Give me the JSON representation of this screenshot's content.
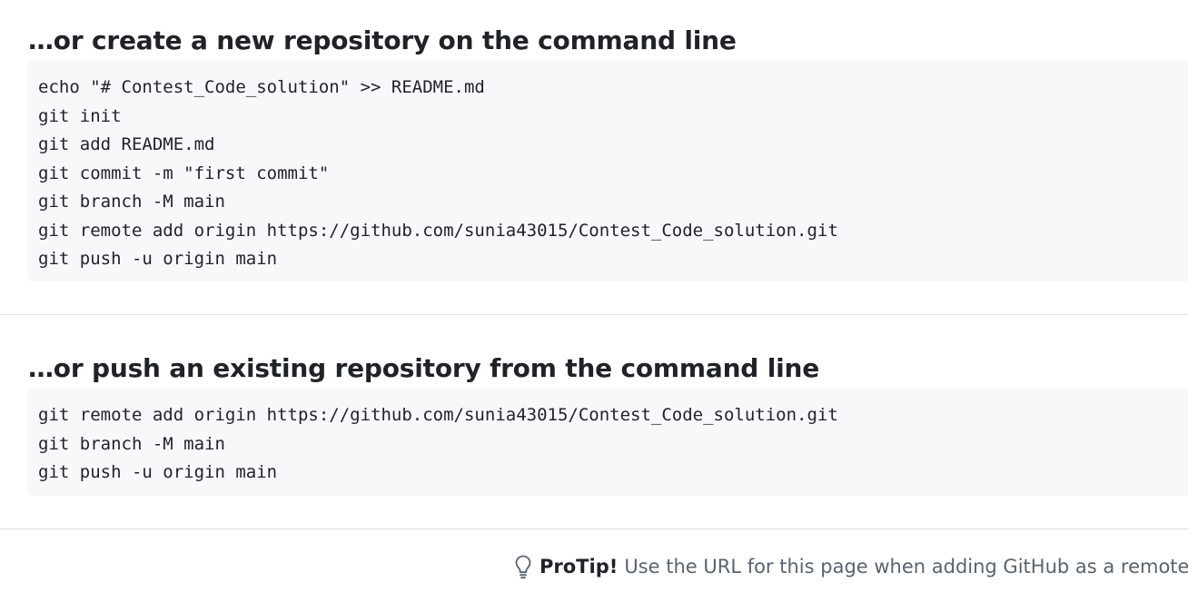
{
  "create_section": {
    "title": "…or create a new repository on the command line",
    "code_lines": [
      "echo \"# Contest_Code_solution\" >> README.md",
      "git init",
      "git add README.md",
      "git commit -m \"first commit\"",
      "git branch -M main",
      "git remote add origin https://github.com/sunia43015/Contest_Code_solution.git",
      "git push -u origin main"
    ]
  },
  "push_section": {
    "title": "…or push an existing repository from the command line",
    "code_lines": [
      "git remote add origin https://github.com/sunia43015/Contest_Code_solution.git",
      "git branch -M main",
      "git push -u origin main"
    ]
  },
  "protip": {
    "icon": "light-bulb-icon",
    "label": "ProTip!",
    "text": "Use the URL for this page when adding GitHub as a remote."
  }
}
